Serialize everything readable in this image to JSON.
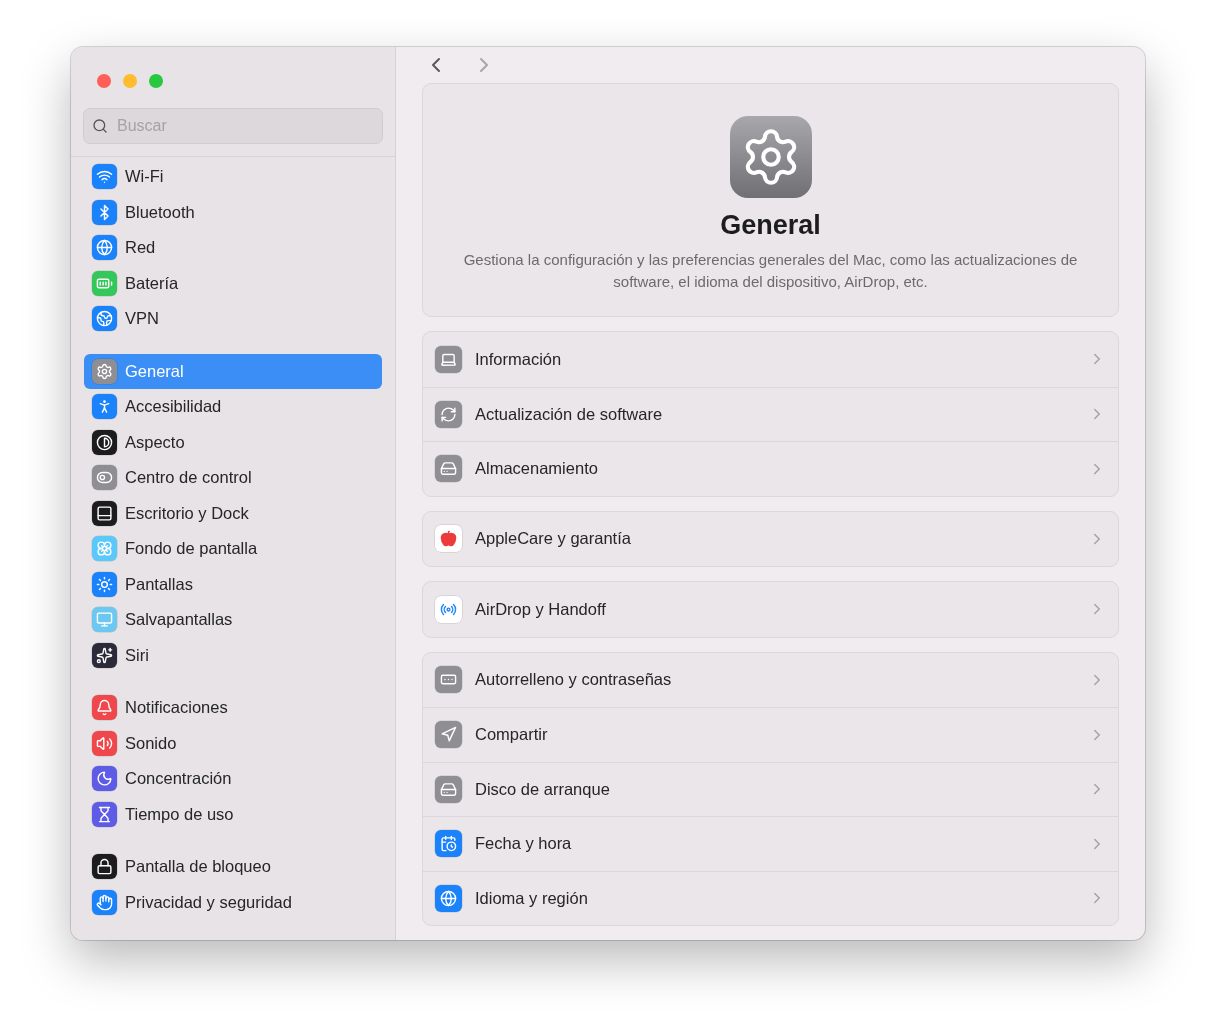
{
  "search": {
    "placeholder": "Buscar"
  },
  "sidebar": {
    "groups": [
      {
        "items": [
          {
            "label": "Wi-Fi",
            "selected": false,
            "color": "#1a82fb"
          },
          {
            "label": "Bluetooth",
            "selected": false,
            "color": "#1a82fb"
          },
          {
            "label": "Red",
            "selected": false,
            "color": "#1a82fb"
          },
          {
            "label": "Batería",
            "selected": false,
            "color": "#34c759"
          },
          {
            "label": "VPN",
            "selected": false,
            "color": "#1a82fb"
          }
        ]
      },
      {
        "items": [
          {
            "label": "General",
            "selected": true,
            "color": "#8e8e93"
          },
          {
            "label": "Accesibilidad",
            "selected": false,
            "color": "#1a82fb"
          },
          {
            "label": "Aspecto",
            "selected": false,
            "color": "#1c1c1e"
          },
          {
            "label": "Centro de control",
            "selected": false,
            "color": "#8e8e93"
          },
          {
            "label": "Escritorio y Dock",
            "selected": false,
            "color": "#1c1c1e"
          },
          {
            "label": "Fondo de pantalla",
            "selected": false,
            "color": "#5ac8fa"
          },
          {
            "label": "Pantallas",
            "selected": false,
            "color": "#1a82fb"
          },
          {
            "label": "Salvapantallas",
            "selected": false,
            "color": "#6cc8f0"
          },
          {
            "label": "Siri",
            "selected": false,
            "color": "#2a2a3a"
          }
        ]
      },
      {
        "items": [
          {
            "label": "Notificaciones",
            "selected": false,
            "color": "#f0474d"
          },
          {
            "label": "Sonido",
            "selected": false,
            "color": "#f0474d"
          },
          {
            "label": "Concentración",
            "selected": false,
            "color": "#5e5ce6"
          },
          {
            "label": "Tiempo de uso",
            "selected": false,
            "color": "#5e5ce6"
          }
        ]
      },
      {
        "items": [
          {
            "label": "Pantalla de bloqueo",
            "selected": false,
            "color": "#1c1c1e"
          },
          {
            "label": "Privacidad y seguridad",
            "selected": false,
            "color": "#1a82fb"
          }
        ]
      }
    ]
  },
  "toolbar": {
    "back": {
      "disabled": false
    },
    "forward": {
      "disabled": true
    }
  },
  "header": {
    "title": "General",
    "description": "Gestiona la configuración y las preferencias generales del Mac, como las actualizaciones de software, el idioma del dispositivo, AirDrop, etc."
  },
  "groups": [
    {
      "rows": [
        {
          "label": "Información",
          "color": "#8e8e93"
        },
        {
          "label": "Actualización de software",
          "color": "#8e8e93"
        },
        {
          "label": "Almacenamiento",
          "color": "#8e8e93"
        }
      ]
    },
    {
      "rows": [
        {
          "label": "AppleCare y garantía",
          "color": "#ffffff"
        }
      ]
    },
    {
      "rows": [
        {
          "label": "AirDrop y Handoff",
          "color": "#ffffff"
        }
      ]
    },
    {
      "rows": [
        {
          "label": "Autorrelleno y contraseñas",
          "color": "#8e8e93"
        },
        {
          "label": "Compartir",
          "color": "#8e8e93"
        },
        {
          "label": "Disco de arranque",
          "color": "#8e8e93"
        },
        {
          "label": "Fecha y hora",
          "color": "#1a82fb"
        },
        {
          "label": "Idioma y región",
          "color": "#1a82fb"
        }
      ]
    }
  ]
}
